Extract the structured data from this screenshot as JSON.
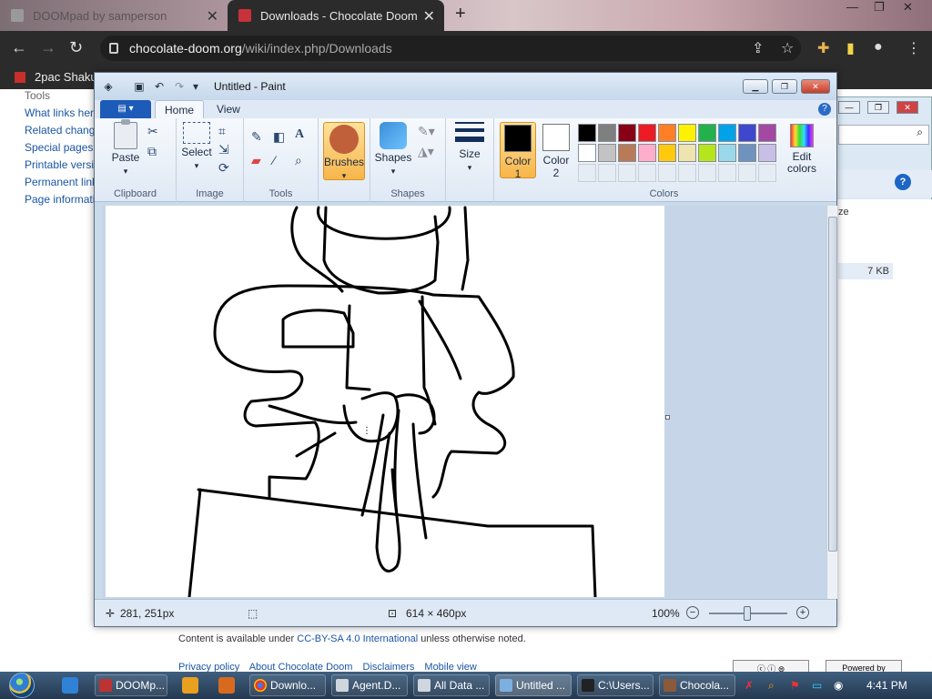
{
  "browser": {
    "tabs": [
      {
        "label": "DOOMpad by samperson"
      },
      {
        "label": "Downloads - Chocolate Doom"
      }
    ],
    "url_host": "chocolate-doom.org",
    "url_path": "/wiki/index.php/Downloads",
    "bookmark": "2pac Shakur"
  },
  "wiki": {
    "tools_heading": "Tools",
    "links": [
      "What links here",
      "Related changes",
      "Special pages",
      "Printable version",
      "Permanent link",
      "Page information"
    ],
    "footer_prefix": "Content is available under ",
    "footer_license": "CC-BY-SA 4.0 International",
    "footer_suffix": " unless otherwise noted.",
    "footer_links": [
      "Privacy policy",
      "About Chocolate Doom",
      "Disclaimers",
      "Mobile view"
    ],
    "badge_powered": "Powered by"
  },
  "explorer": {
    "col_fragment": "ze",
    "file_size": "7 KB"
  },
  "paint": {
    "title": "Untitled - Paint",
    "tabs": {
      "home": "Home",
      "view": "View"
    },
    "groups": {
      "clipboard": "Clipboard",
      "image": "Image",
      "tools": "Tools",
      "shapes": "Shapes",
      "colors": "Colors"
    },
    "buttons": {
      "paste": "Paste",
      "select": "Select",
      "brushes": "Brushes",
      "shapes": "Shapes",
      "size": "Size",
      "color1": "Color",
      "color1_num": "1",
      "color2": "Color",
      "color2_num": "2",
      "edit_colors_1": "Edit",
      "edit_colors_2": "colors"
    },
    "color1_value": "#000000",
    "color2_value": "#ffffff",
    "palette": [
      "#000000",
      "#7f7f7f",
      "#880015",
      "#ed1c24",
      "#ff7f27",
      "#fff200",
      "#22b14c",
      "#00a2e8",
      "#3f48cc",
      "#a349a4",
      "#ffffff",
      "#c3c3c3",
      "#b97a57",
      "#ffaec9",
      "#ffc90e",
      "#efe4b0",
      "#b5e61d",
      "#99d9ea",
      "#7092be",
      "#c8bfe7"
    ],
    "status": {
      "cursor": "281, 251px",
      "dimensions": "614 × 460px",
      "zoom": "100%"
    }
  },
  "taskbar": {
    "items": [
      "DOOMp...",
      "Downlo...",
      "Agent.D...",
      "All Data ...",
      "Untitled ...",
      "C:\\Users...",
      "Chocola..."
    ],
    "clock": "4:41 PM"
  }
}
